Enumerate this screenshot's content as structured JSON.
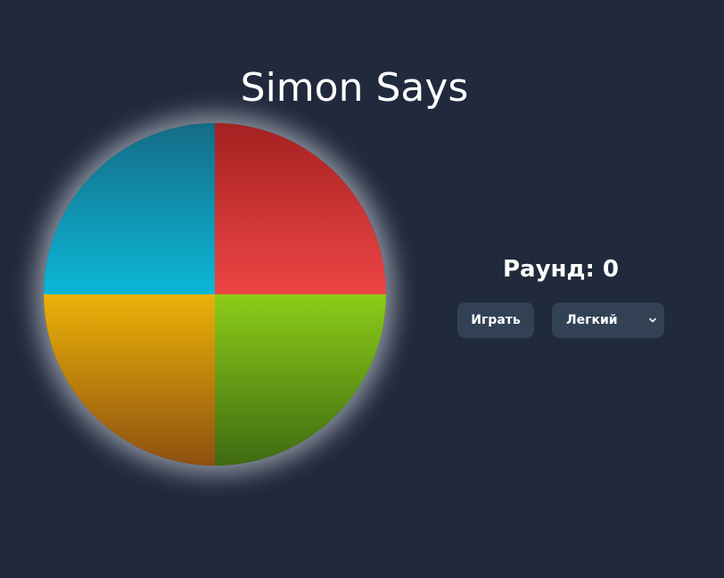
{
  "header": {
    "title": "Simon Says"
  },
  "board": {
    "pads": [
      {
        "name": "blue",
        "color": "#0bb7d6"
      },
      {
        "name": "red",
        "color": "#ee4545"
      },
      {
        "name": "yellow",
        "color": "#ebb208"
      },
      {
        "name": "green",
        "color": "#8ccd18"
      }
    ]
  },
  "status": {
    "round_label": "Раунд: 0"
  },
  "controls": {
    "play_label": "Играть",
    "difficulty": {
      "selected": "Легкий",
      "icon": "chevron-down-icon"
    }
  }
}
